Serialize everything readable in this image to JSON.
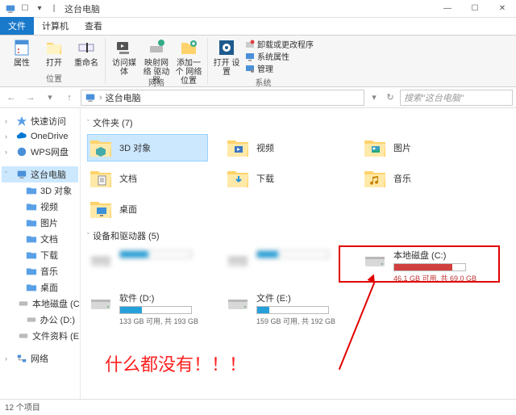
{
  "titlebar": {
    "title": "这台电脑"
  },
  "tabs": {
    "file": "文件",
    "computer": "计算机",
    "view": "查看"
  },
  "ribbon": {
    "group1": {
      "props": "属性",
      "open": "打开",
      "rename": "重命名",
      "cap": "位置"
    },
    "group2": {
      "media": "访问媒体",
      "mapnet": "映射网络\n驱动器",
      "addnet": "添加一个\n网络位置",
      "cap": "网络"
    },
    "group3": {
      "opensettings": "打开\n设置",
      "uninstall": "卸载或更改程序",
      "sysprops": "系统属性",
      "manage": "管理",
      "cap": "系统"
    }
  },
  "nav": {
    "crumb": "这台电脑",
    "search_ph": "搜索\"这台电脑\""
  },
  "sidebar": {
    "items": [
      {
        "icon": "star",
        "label": "快速访问",
        "exp": "›"
      },
      {
        "icon": "cloud",
        "label": "OneDrive",
        "exp": "›"
      },
      {
        "icon": "wps",
        "label": "WPS网盘",
        "exp": "›"
      },
      {
        "icon": "pc",
        "label": "这台电脑",
        "exp": "ˇ",
        "sel": true
      },
      {
        "icon": "3d",
        "label": "3D 对象",
        "indent": true
      },
      {
        "icon": "video",
        "label": "视频",
        "indent": true
      },
      {
        "icon": "pic",
        "label": "图片",
        "indent": true
      },
      {
        "icon": "doc",
        "label": "文档",
        "indent": true
      },
      {
        "icon": "down",
        "label": "下载",
        "indent": true
      },
      {
        "icon": "music",
        "label": "音乐",
        "indent": true
      },
      {
        "icon": "desk",
        "label": "桌面",
        "indent": true
      },
      {
        "icon": "drive",
        "label": "本地磁盘 (C:)",
        "indent": true
      },
      {
        "icon": "drive",
        "label": "办公 (D:)",
        "indent": true
      },
      {
        "icon": "drive",
        "label": "文件资料 (E:)",
        "indent": true
      },
      {
        "icon": "net",
        "label": "网络",
        "exp": "›"
      }
    ]
  },
  "sections": {
    "folders_hdr": "文件夹 (7)",
    "drives_hdr": "设备和驱动器 (5)"
  },
  "folders": [
    {
      "label": "3D 对象",
      "sel": true,
      "ic": "folder3d"
    },
    {
      "label": "视频",
      "ic": "video"
    },
    {
      "label": "图片",
      "ic": "pic"
    },
    {
      "label": "文档",
      "ic": "doc"
    },
    {
      "label": "下载",
      "ic": "down"
    },
    {
      "label": "音乐",
      "ic": "music"
    },
    {
      "label": "桌面",
      "ic": "desk"
    }
  ],
  "drives": [
    {
      "name": "",
      "stat": "",
      "fill": 40,
      "blur": true
    },
    {
      "name": "",
      "stat": "",
      "fill": 30,
      "blur": true
    },
    {
      "name": "本地磁盘 (C:)",
      "stat": "46.1 GB 可用, 共 69.0 GB",
      "fill": 82,
      "red": true
    },
    {
      "name": "软件 (D:)",
      "stat": "133 GB 可用, 共 193 GB",
      "fill": 31
    },
    {
      "name": "文件 (E:)",
      "stat": "159 GB 可用, 共 192 GB",
      "fill": 17
    }
  ],
  "status": "12 个项目",
  "annotation": "什么都没有！！！"
}
